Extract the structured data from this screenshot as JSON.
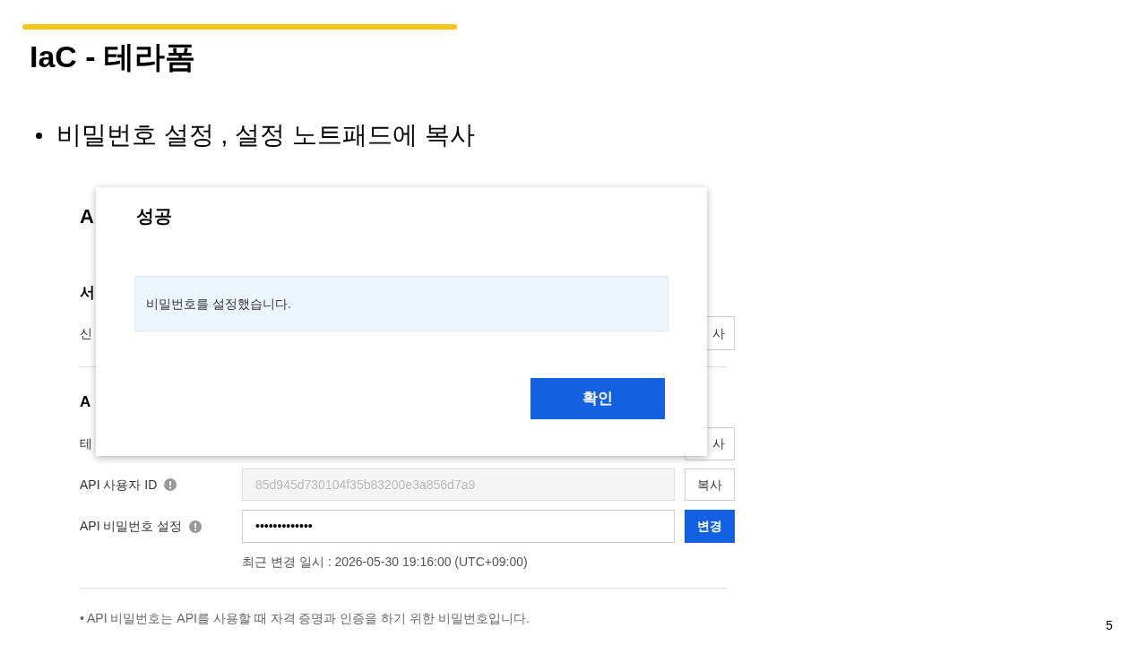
{
  "slide": {
    "title": "IaC - 테라폼",
    "bullets": [
      "비밀번호 설정 , 설정 노트패드에 복사"
    ],
    "page_number": "5"
  },
  "screenshot": {
    "heading": "A",
    "section_heading": "서",
    "row_label": "신",
    "row_button": "사",
    "section2_heading": "A",
    "row2_label": "테",
    "row2_button": "사",
    "fields": [
      {
        "kind": "copy",
        "label": "API 사용자 ID",
        "value": "85d945d730104f35b83200e3a856d7a9",
        "disabled": true,
        "button": "복사"
      },
      {
        "kind": "change",
        "label": "API 비밀번호 설정",
        "value": "•••••••••••••",
        "disabled": false,
        "button": "변경"
      }
    ],
    "last_changed": "최근 변경 일시 : 2026-05-30 19:16:00 (UTC+09:00)",
    "note": "• API 비밀번호는 API를 사용할 때 자격 증명과 인증을 하기 위한 비밀번호입니다.",
    "dialog": {
      "title": "성공",
      "message": "비밀번호를 설정했습니다.",
      "confirm_button": "확인"
    }
  }
}
